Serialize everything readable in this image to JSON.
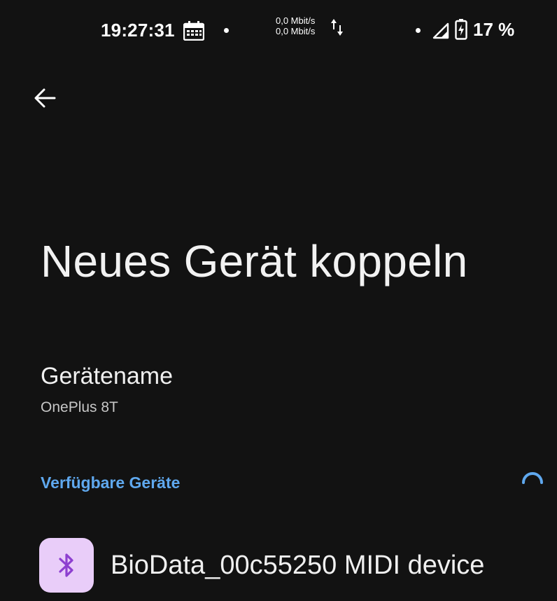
{
  "status_bar": {
    "time": "19:27:31",
    "net_speed_up": "0,0 Mbit/s",
    "net_speed_down": "0,0 Mbit/s",
    "battery_percent": "17 %",
    "icons": [
      "calendar-icon",
      "notification-dot-icon",
      "data-transfer-icon",
      "signal-icon",
      "battery-charging-icon"
    ]
  },
  "toolbar": {
    "back_icon": "arrow-back-icon"
  },
  "page": {
    "title": "Neues Gerät koppeln"
  },
  "device_name": {
    "label": "Gerätename",
    "value": "OnePlus 8T"
  },
  "available_devices": {
    "header": "Verfügbare Geräte",
    "items": [
      {
        "label": "BioData_00c55250 MIDI device",
        "icon": "bluetooth-icon"
      }
    ]
  },
  "colors": {
    "background": "#121212",
    "accent": "#5fa8ee",
    "device_icon_bg": "#e9cdf9",
    "bluetooth_icon": "#8d3fd0"
  }
}
